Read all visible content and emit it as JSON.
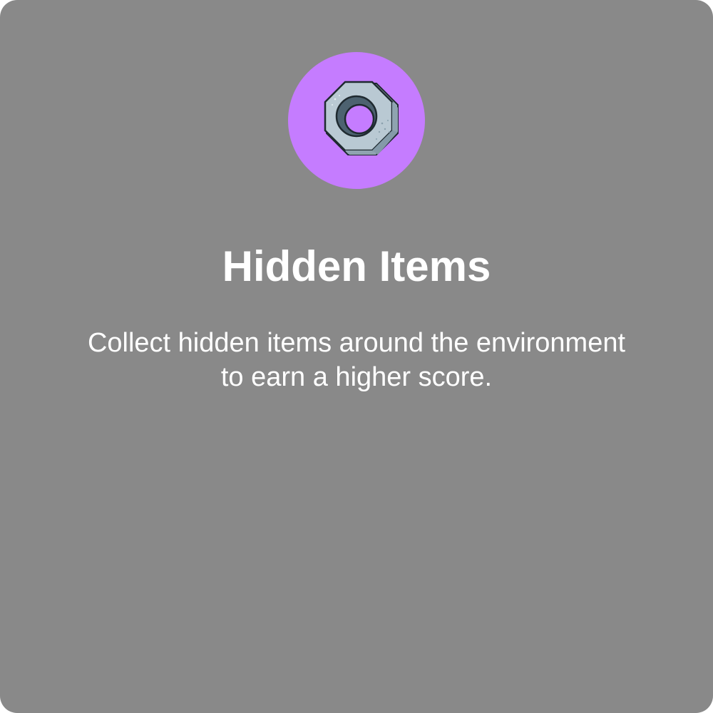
{
  "card": {
    "title": "Hidden Items",
    "description_line1": "Collect hidden items around the environment",
    "description_line2": "to earn a higher score.",
    "icon": "hex-nut-icon"
  },
  "colors": {
    "card_background": "#898989",
    "badge_background": "#c57cff",
    "text": "#ffffff",
    "nut_face": "#b9c9d3",
    "nut_side": "#95a9b6",
    "nut_outline": "#1f2a30"
  }
}
